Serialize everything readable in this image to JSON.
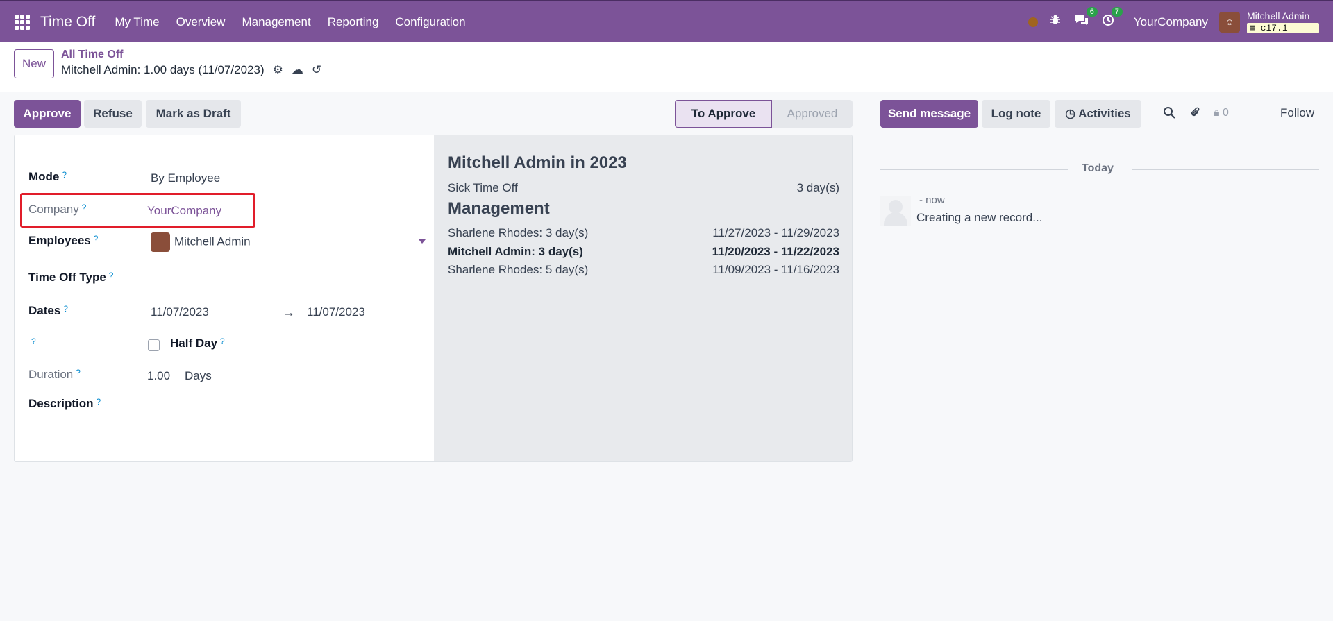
{
  "navbar": {
    "app_name": "Time Off",
    "menu": [
      "My Time",
      "Overview",
      "Management",
      "Reporting",
      "Configuration"
    ],
    "chat_badge": "6",
    "activity_badge": "7",
    "company": "YourCompany",
    "user_name": "Mitchell Admin",
    "db_name": "c17.1"
  },
  "control": {
    "new_label": "New",
    "breadcrumb_parent": "All Time Off",
    "breadcrumb_current": "Mitchell Admin: 1.00 days (11/07/2023)"
  },
  "statusbar": {
    "approve": "Approve",
    "refuse": "Refuse",
    "draft": "Mark as Draft",
    "stage_active": "To Approve",
    "stage_next": "Approved"
  },
  "form": {
    "mode_label": "Mode",
    "mode_value": "By Employee",
    "company_label": "Company",
    "company_value": "YourCompany",
    "employees_label": "Employees",
    "employee_value": "Mitchell Admin",
    "type_label": "Time Off Type",
    "dates_label": "Dates",
    "date_from": "11/07/2023",
    "date_to": "11/07/2023",
    "half_day_label": "Half Day",
    "duration_label": "Duration",
    "duration_value": "1.00",
    "duration_unit": "Days",
    "description_label": "Description",
    "help_mark": "?"
  },
  "summary": {
    "title": "Mitchell Admin in 2023",
    "sick_label": "Sick Time Off",
    "sick_value": "3 day(s)",
    "management_title": "Management",
    "rows": [
      {
        "name": "Sharlene Rhodes: 3 day(s)",
        "range": "11/27/2023 - 11/29/2023"
      },
      {
        "name": "Mitchell Admin: 3 day(s)",
        "range": "11/20/2023 - 11/22/2023"
      },
      {
        "name": "Sharlene Rhodes: 5 day(s)",
        "range": "11/09/2023 - 11/16/2023"
      }
    ]
  },
  "chatter": {
    "send": "Send message",
    "log": "Log note",
    "activities": "Activities",
    "followers_count": "0",
    "follow": "Follow",
    "today": "Today",
    "msg_time": "- now",
    "msg_text": "Creating a new record..."
  },
  "colors": {
    "brand": "#7c5398",
    "highlight_box": "#e11d2a"
  }
}
